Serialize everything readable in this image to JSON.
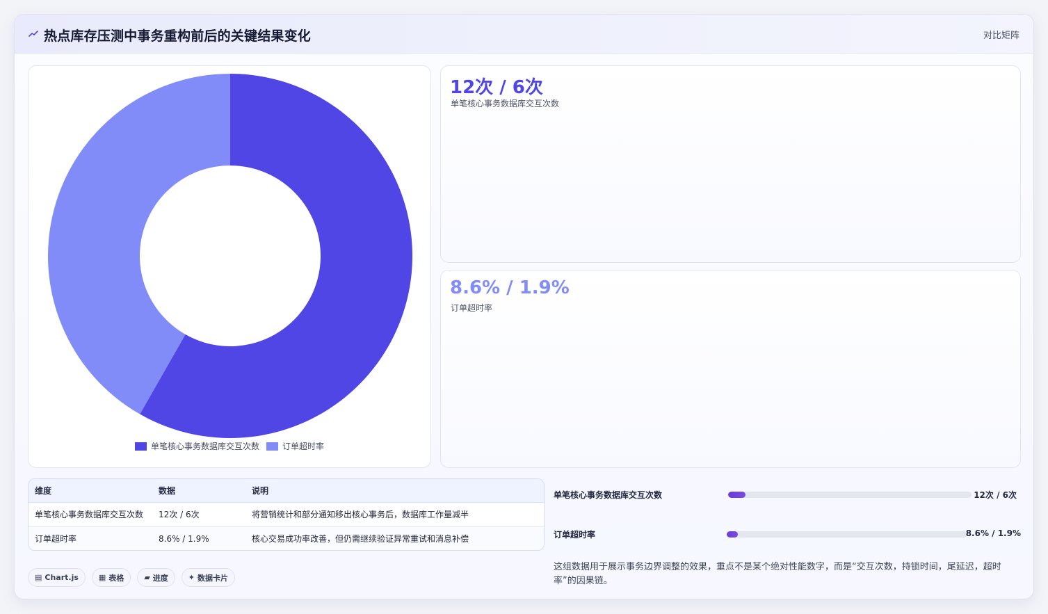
{
  "header": {
    "title": "热点库存压测中事务重构前后的关键结果变化",
    "link": "对比矩阵"
  },
  "chart_data": {
    "type": "pie",
    "categories": [
      "单笔核心事务数据库交互次数",
      "订单超时率"
    ],
    "values": [
      12,
      8.6
    ],
    "colors": [
      "#4f46e5",
      "#818cf8"
    ],
    "legend_position": "bottom"
  },
  "stats": [
    {
      "value": "12次 / 6次",
      "label": "单笔核心事务数据库交互次数",
      "color": "#4f46e5"
    },
    {
      "value": "8.6% / 1.9%",
      "label": "订单超时率",
      "color": "#818cf8"
    }
  ],
  "table": {
    "headers": [
      "维度",
      "数据",
      "说明"
    ],
    "rows": [
      [
        "单笔核心事务数据库交互次数",
        "12次 / 6次",
        "将营销统计和部分通知移出核心事务后，数据库工作量减半"
      ],
      [
        "订单超时率",
        "8.6% / 1.9%",
        "核心交易成功率改善，但仍需继续验证异常重试和消息补偿"
      ]
    ]
  },
  "chips": [
    {
      "icon": "▤",
      "label": "Chart.js"
    },
    {
      "icon": "▦",
      "label": "表格"
    },
    {
      "icon": "▰",
      "label": "进度"
    },
    {
      "icon": "✦",
      "label": "数据卡片"
    }
  ],
  "progress": [
    {
      "label": "单笔核心事务数据库交互次数",
      "value": "12次 / 6次",
      "fill_fraction": 0.07
    },
    {
      "label": "订单超时率",
      "value": "8.6% / 1.9%",
      "fill_fraction": 0.045
    }
  ],
  "note": "这组数据用于展示事务边界调整的效果，重点不是某个绝对性能数字，而是“交互次数，持锁时间，尾延迟，超时率”的因果链。"
}
